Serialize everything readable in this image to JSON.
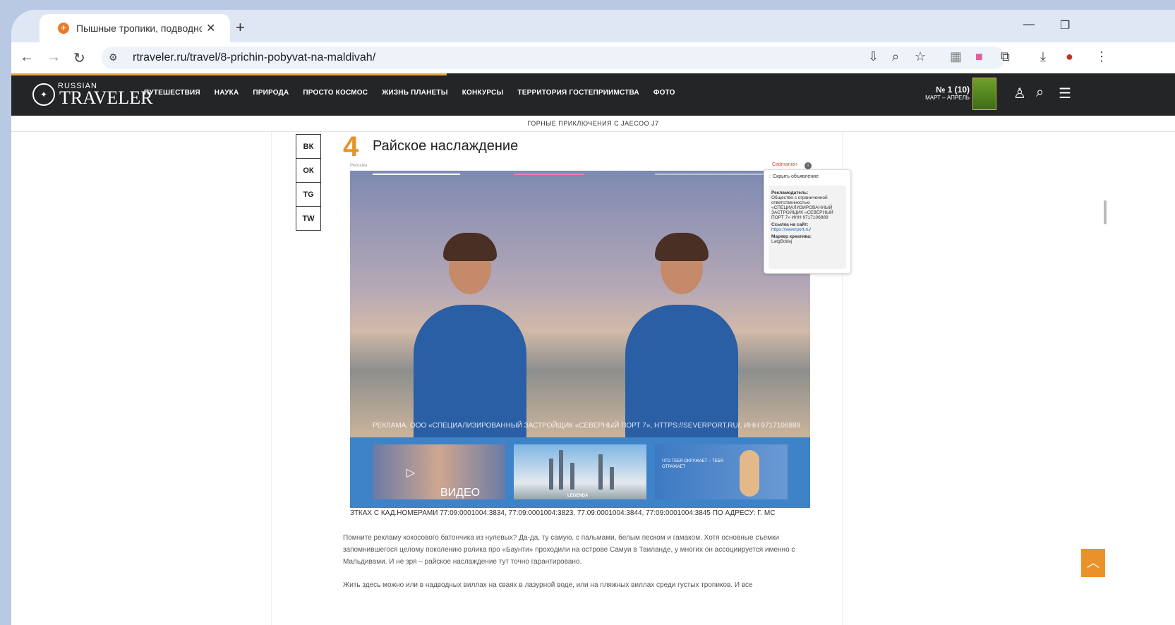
{
  "browser": {
    "tab_title": "Пышные тропики, подводное",
    "url": "rtraveler.ru/travel/8-prichin-pobyvat-na-maldivah/"
  },
  "site": {
    "logo_small": "RUSSIAN",
    "logo_big": "TRAVELER",
    "nav": [
      "ПУТЕШЕСТВИЯ",
      "НАУКА",
      "ПРИРОДА",
      "ПРОСТО КОСМОС",
      "ЖИЗНЬ ПЛАНЕТЫ",
      "КОНКУРСЫ",
      "ТЕРРИТОРИЯ ГОСТЕПРИИМСТВА",
      "ФОТО"
    ],
    "issue_number": "№ 1 (10)",
    "issue_months": "МАРТ – АПРЕЛЬ",
    "promo": "ГОРНЫЕ ПРИКЛЮЧЕНИЯ С JAECOO J7"
  },
  "article": {
    "section_number": "4",
    "section_title": "Райское наслаждение",
    "paragraph1": "Помните рекламу кокосового батончика из нулевых? Да-да, ту самую, с пальмами, белым песком и гамаком. Хотя основные съемки запомнившегося целому поколению ролика про «Баунти» проходили на острове Самуи в Таиланде, у многих он ассоциируется именно с Мальдивами. И не зря – райское наслаждение тут точно гарантировано.",
    "paragraph2": "Жить здесь можно или в надводных виллах на сваях в лазурной воде, или на пляжных виллах среди густых тропиков. И все"
  },
  "share": [
    "ВК",
    "ОК",
    "TG",
    "TW"
  ],
  "ad": {
    "label": "Реклама",
    "brand": "Cadmanion",
    "caption": "РЕКЛАМА. ООО «СПЕЦИАЛИЗИРОВАННЫЙ ЗАСТРОЙЩИК «СЕВЕРНЫЙ ПОРТ 7», HTTPS://SEVERPORT.RU/, ИНН 9717106889",
    "video_label": "ВИДЕО",
    "legend": "LEGENDA",
    "thumb3": "ЧТО ТЕБЯ ОКРУЖАЕТ – ТЕБЯ ОТРАЖАЕТ",
    "cadastr": "ЗТКАХ С КАД.НОМЕРАМИ 77:09:0001004:3834, 77:09:0001004:3823, 77:09:0001004:3844, 77:09:0001004:3845 ПО АДРЕСУ: Г. МС",
    "hide": "Скрыть объявление",
    "advertiser_label": "Рекламодатель:",
    "advertiser": "Общество с ограниченной ответственностью «СПЕЦИАЛИЗИРОВАННЫЙ ЗАСТРОЙЩИК «СЕВЕРНЫЙ ПОРТ 7» ИНН 9717106889",
    "site_label": "Ссылка на сайт:",
    "site": "https://severport.ru/",
    "marker_label": "Маркер креатива:",
    "marker": "LatgBddej"
  }
}
